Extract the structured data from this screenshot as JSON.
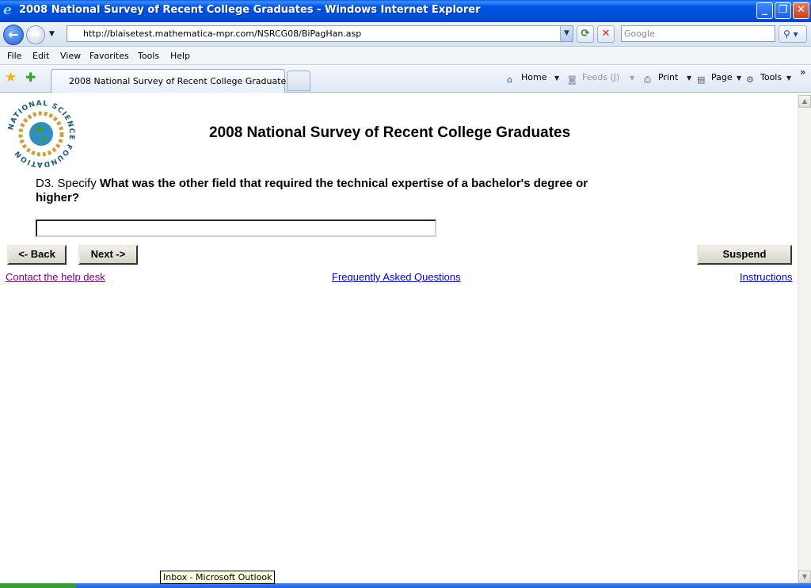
{
  "window": {
    "title": "2008 National Survey of Recent College Graduates - Windows Internet Explorer",
    "minimize": "_",
    "maximize": "❐",
    "close": "✕"
  },
  "address": {
    "url": "http://blaisetest.mathematica-mpr.com/NSRCG08/BiPagHan.asp",
    "search_placeholder": "Google"
  },
  "menu": [
    "File",
    "Edit",
    "View",
    "Favorites",
    "Tools",
    "Help"
  ],
  "tab": {
    "label": "2008 National Survey of Recent College Graduates"
  },
  "commands": {
    "home": "Home",
    "feeds": "Feeds (J)",
    "print": "Print",
    "page": "Page",
    "tools": "Tools",
    "more": "»"
  },
  "page": {
    "logo_text": "NATIONAL SCIENCE FOUNDATION",
    "title": "2008 National Survey of Recent College Graduates",
    "question_prefix": "D3. Specify ",
    "question_text": "What was the other field that required the technical expertise of a bachelor's degree or higher?",
    "answer_value": "",
    "back_label": "<- Back",
    "next_label": "Next ->",
    "suspend_label": "Suspend",
    "help_link": "Contact the help desk",
    "faq_link": "Frequently Asked Questions",
    "instructions_link": "Instructions"
  },
  "tooltip": "Inbox - Microsoft Outlook",
  "colors": {
    "link_visited": "#800080",
    "link": "#0000cc",
    "titlebar": "#0054e3"
  }
}
